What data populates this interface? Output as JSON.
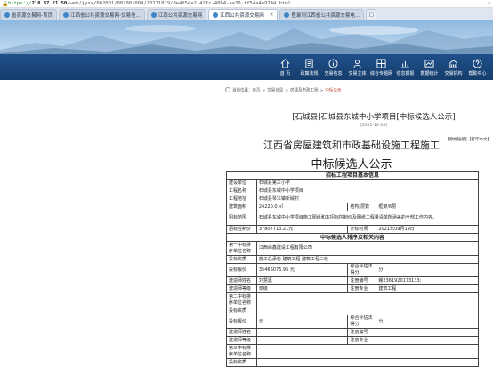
{
  "browser": {
    "url_scheme": "https://",
    "url_host": "218.87.21.50",
    "url_path": "/web/jyxx/002001/002001004/20211019/0e4f54a2-42fc-4804-aa30-ff54a4e9744.html",
    "tabs": [
      {
        "label": "省资源交易网-首页",
        "active": false
      },
      {
        "label": "江西省公共资源交易网-交易信...",
        "active": false
      },
      {
        "label": "江西公共资源交易网",
        "active": false
      },
      {
        "label": "江西公共资源交易网",
        "active": true
      },
      {
        "label": "登录到江西省公共资源交易电...",
        "active": false
      }
    ]
  },
  "nav": {
    "items": [
      {
        "label": "首 页",
        "icon": "home-icon"
      },
      {
        "label": "政策法规",
        "icon": "document-icon"
      },
      {
        "label": "交易信息",
        "icon": "info-icon"
      },
      {
        "label": "交易主体",
        "icon": "people-icon"
      },
      {
        "label": "综合专题网",
        "icon": "grid-icon"
      },
      {
        "label": "信息报报",
        "icon": "chart-icon"
      },
      {
        "label": "数据统计",
        "icon": "stats-icon"
      },
      {
        "label": "交易机构",
        "icon": "building-icon"
      },
      {
        "label": "帮助中心",
        "icon": "help-icon"
      }
    ]
  },
  "breadcrumb": {
    "prefix": "当前位置：",
    "items": [
      "首页",
      "交易信息",
      "房建及市政工程",
      "中标公示"
    ]
  },
  "doc": {
    "title": "[石城县]石城县东城中小学项目[中标候选人公示]",
    "date": "[2021-10-19]",
    "links": "【原始链接】【打印本文】",
    "heading1": "江西省房屋建筑和市政基础设施工程施工",
    "heading2": "中标候选人公示",
    "section1": "招标工程项目基本信息",
    "rows1": [
      {
        "k": "建设单位",
        "v": "石城县第三小学"
      },
      {
        "k": "工程名称",
        "v": "石城县东城中小学项目"
      },
      {
        "k": "工程地址",
        "v": "石城县琴江镇新塅村"
      }
    ],
    "area": {
      "k": "建筑面积",
      "v": "24220.0 ㎡",
      "k2": "结构/层数",
      "v2": "框架/6层"
    },
    "scope": {
      "k": "招标范围",
      "v": "石城县东城中小学项目施工图纸和本招标控制价及图纸工程量清单所涵盖的全部工作内容。"
    },
    "price": {
      "k": "招标控制价",
      "v": "37807713.21元",
      "k2": "开标时间",
      "v2": "2021年09月19日"
    },
    "section2": "中标候选人排序及相关内容",
    "cand1": {
      "name_k": "第一中标排序单位名称",
      "name_v": "江西尚鑫建设工程有限公司",
      "qual_k": "投标资质",
      "qual_v": "施工总承包 建筑工程 建筑工程三级",
      "bid_k": "投标报价",
      "bid_v": "35466076.95 元",
      "score_k": "综合评估法得分",
      "score_v": "分",
      "pm_k": "建造师姓名",
      "pm_v": "刘慧嘉",
      "reg_k": "注册编号",
      "reg_v": "赣2361920173133;",
      "lvl_k": "建造师等级",
      "lvl_v": "贰级",
      "spec_k": "注册专业",
      "spec_v": "建筑工程"
    },
    "cand2": {
      "name_k": "第二中标排序单位名称",
      "name_v": "",
      "qual_k": "投标资质",
      "qual_v": "",
      "bid_k": "投标报价",
      "bid_v": "元",
      "score_k": "综合评估法得分",
      "score_v": "分",
      "pm_k": "建造师姓名",
      "pm_v": "",
      "reg_k": "注册编号",
      "reg_v": "",
      "lvl_k": "建造师等级",
      "lvl_v": "",
      "spec_k": "注册专业",
      "spec_v": ""
    },
    "cand3": {
      "name_k": "第三中标排序单位名称",
      "qual_k": "投标资质"
    }
  }
}
